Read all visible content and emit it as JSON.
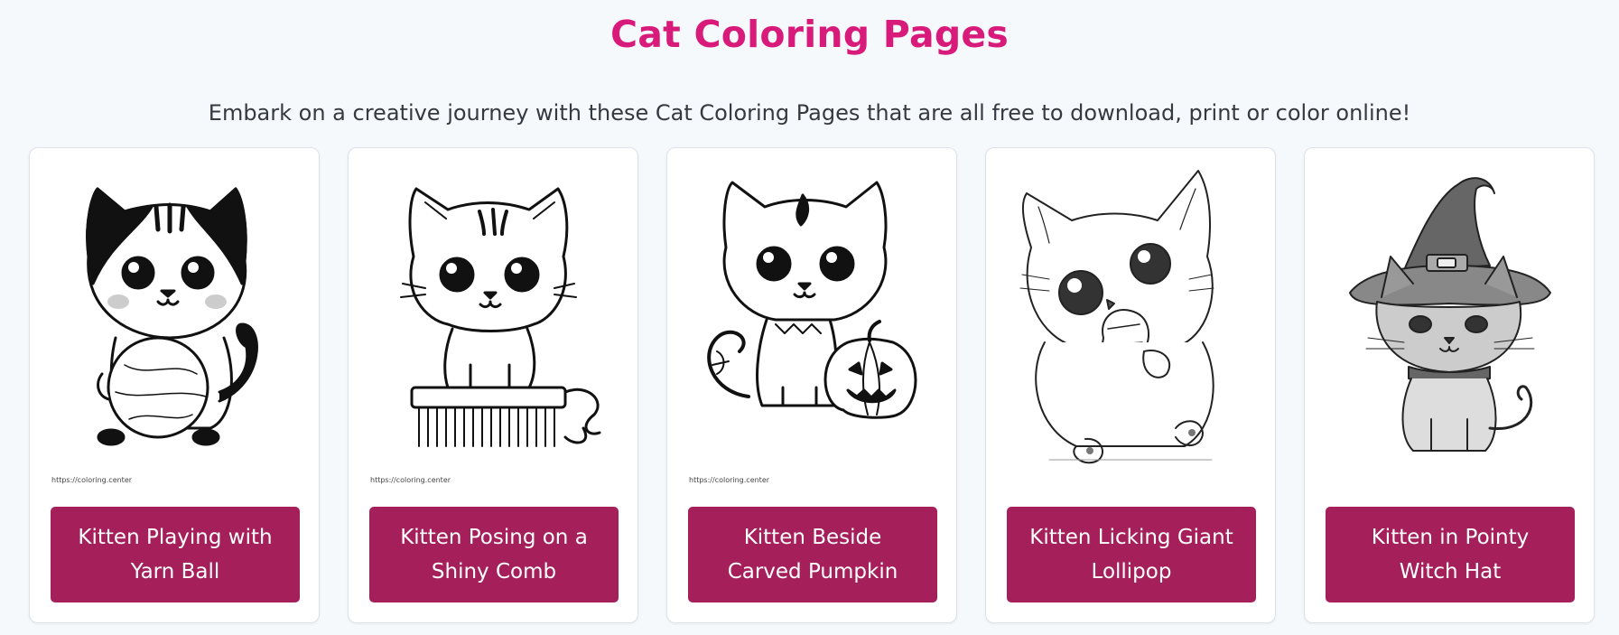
{
  "page": {
    "title": "Cat Coloring Pages",
    "subtitle": "Embark on a creative journey with these Cat Coloring Pages that are all free to download, print or color online!"
  },
  "colors": {
    "title": "#d81b7a",
    "button_bg": "#a51f5b",
    "button_text": "#ffffff",
    "background": "#f6f9fc"
  },
  "cards": [
    {
      "label": "Kitten Playing with Yarn Ball",
      "watermark": "https://coloring.center",
      "icon": "kitten-yarn-ball-illustration"
    },
    {
      "label": "Kitten Posing on a Shiny Comb",
      "watermark": "https://coloring.center",
      "icon": "kitten-comb-illustration"
    },
    {
      "label": "Kitten Beside Carved Pumpkin",
      "watermark": "https://coloring.center",
      "icon": "kitten-pumpkin-illustration"
    },
    {
      "label": "Kitten Licking Giant Lollipop",
      "watermark": "",
      "icon": "kitten-lollipop-illustration"
    },
    {
      "label": "Kitten in Pointy Witch Hat",
      "watermark": "",
      "icon": "kitten-witch-hat-illustration"
    }
  ]
}
